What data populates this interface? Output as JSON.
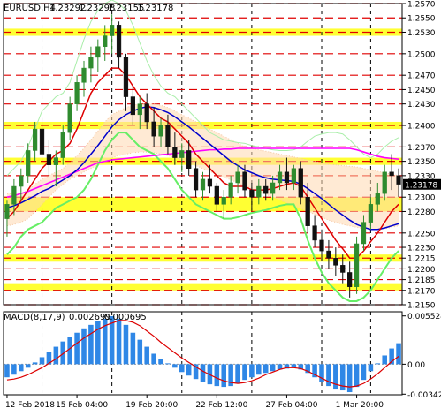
{
  "chart_data": [
    {
      "type": "candlestick",
      "title": "EURUSD,H4",
      "ohlc_readout": {
        "open": "1.23292",
        "high": "1.23298",
        "low": "1.23155",
        "close": "1.23178"
      },
      "ylim": [
        1.215,
        1.257
      ],
      "price_tick_labels": [
        "1.2570",
        "1.2550",
        "1.2530",
        "1.2500",
        "1.2470",
        "1.2450",
        "1.2430",
        "1.2400",
        "1.2370",
        "1.2350",
        "1.2330",
        "1.2300",
        "1.2280",
        "1.2250",
        "1.2230",
        "1.2215",
        "1.2200",
        "1.2185",
        "1.2170",
        "1.2150"
      ],
      "tick_values": [
        1.257,
        1.255,
        1.253,
        1.25,
        1.247,
        1.245,
        1.243,
        1.24,
        1.237,
        1.235,
        1.233,
        1.23,
        1.228,
        1.225,
        1.223,
        1.2215,
        1.22,
        1.2185,
        1.217,
        1.215
      ],
      "current_price_label": "1.23178",
      "current_price": 1.23178,
      "colors": {
        "bull": "#2e8b2e",
        "bear": "#111111",
        "level_line": "#e00000",
        "zone_fill": "#ffff33",
        "sma_fast": "#dd0000",
        "sma_slow": "#0000cc",
        "long_ma": "#ff00ff",
        "bollinger": "#66ee66",
        "envelope": "#aaeeaa",
        "cloud_a": "#f5c7a3",
        "cloud_b": "#ffd8b0",
        "macd_hist": "#2f87e6",
        "macd_signal": "#dd0000"
      },
      "zones": [
        [
          1.2525,
          1.2535
        ],
        [
          1.2395,
          1.2405
        ],
        [
          1.2345,
          1.2355
        ],
        [
          1.228,
          1.23
        ],
        [
          1.221,
          1.222
        ],
        [
          1.217,
          1.218
        ]
      ],
      "candles": [
        [
          1.227,
          1.2295,
          1.2245,
          1.229
        ],
        [
          1.229,
          1.2325,
          1.2275,
          1.2315
        ],
        [
          1.2315,
          1.234,
          1.2295,
          1.233
        ],
        [
          1.233,
          1.2375,
          1.232,
          1.2365
        ],
        [
          1.2365,
          1.2405,
          1.235,
          1.2395
        ],
        [
          1.2395,
          1.241,
          1.235,
          1.236
        ],
        [
          1.236,
          1.238,
          1.233,
          1.2345
        ],
        [
          1.2345,
          1.2365,
          1.2315,
          1.2355
        ],
        [
          1.2355,
          1.24,
          1.2345,
          1.239
        ],
        [
          1.239,
          1.244,
          1.238,
          1.243
        ],
        [
          1.243,
          1.247,
          1.242,
          1.246
        ],
        [
          1.246,
          1.249,
          1.244,
          1.248
        ],
        [
          1.248,
          1.251,
          1.246,
          1.2495
        ],
        [
          1.2495,
          1.252,
          1.2475,
          1.251
        ],
        [
          1.251,
          1.254,
          1.249,
          1.2525
        ],
        [
          1.2525,
          1.2555,
          1.25,
          1.254
        ],
        [
          1.254,
          1.2545,
          1.248,
          1.2495
        ],
        [
          1.2495,
          1.25,
          1.242,
          1.244
        ],
        [
          1.244,
          1.2455,
          1.24,
          1.2415
        ],
        [
          1.2415,
          1.244,
          1.2395,
          1.243
        ],
        [
          1.243,
          1.2445,
          1.2395,
          1.2405
        ],
        [
          1.2405,
          1.2425,
          1.237,
          1.2385
        ],
        [
          1.2385,
          1.241,
          1.237,
          1.24
        ],
        [
          1.24,
          1.2415,
          1.236,
          1.237
        ],
        [
          1.237,
          1.239,
          1.2345,
          1.2355
        ],
        [
          1.2355,
          1.2375,
          1.2335,
          1.2365
        ],
        [
          1.2365,
          1.238,
          1.233,
          1.234
        ],
        [
          1.234,
          1.235,
          1.23,
          1.231
        ],
        [
          1.231,
          1.2335,
          1.2295,
          1.2325
        ],
        [
          1.2325,
          1.2345,
          1.2305,
          1.2315
        ],
        [
          1.2315,
          1.232,
          1.228,
          1.229
        ],
        [
          1.229,
          1.231,
          1.227,
          1.23
        ],
        [
          1.23,
          1.233,
          1.229,
          1.232
        ],
        [
          1.232,
          1.2345,
          1.2305,
          1.2335
        ],
        [
          1.2335,
          1.2345,
          1.23,
          1.231
        ],
        [
          1.231,
          1.232,
          1.2285,
          1.23
        ],
        [
          1.23,
          1.2325,
          1.229,
          1.2315
        ],
        [
          1.2315,
          1.2325,
          1.2295,
          1.2305
        ],
        [
          1.2305,
          1.233,
          1.2295,
          1.232
        ],
        [
          1.232,
          1.2345,
          1.231,
          1.2335
        ],
        [
          1.2335,
          1.2355,
          1.231,
          1.232
        ],
        [
          1.232,
          1.2345,
          1.231,
          1.234
        ],
        [
          1.234,
          1.235,
          1.229,
          1.23
        ],
        [
          1.23,
          1.232,
          1.225,
          1.226
        ],
        [
          1.226,
          1.2275,
          1.223,
          1.224
        ],
        [
          1.224,
          1.2255,
          1.2215,
          1.2225
        ],
        [
          1.2225,
          1.224,
          1.22,
          1.2215
        ],
        [
          1.2215,
          1.223,
          1.219,
          1.2205
        ],
        [
          1.2205,
          1.222,
          1.218,
          1.2195
        ],
        [
          1.2195,
          1.221,
          1.216,
          1.2175
        ],
        [
          1.2175,
          1.2245,
          1.2165,
          1.2235
        ],
        [
          1.2235,
          1.2275,
          1.2225,
          1.2265
        ],
        [
          1.2265,
          1.23,
          1.2255,
          1.229
        ],
        [
          1.229,
          1.232,
          1.228,
          1.2305
        ],
        [
          1.2305,
          1.2345,
          1.2295,
          1.2335
        ],
        [
          1.2335,
          1.236,
          1.231,
          1.233
        ],
        [
          1.233,
          1.234,
          1.23,
          1.2318
        ]
      ],
      "sma_fast": [
        1.227,
        1.228,
        1.2295,
        1.231,
        1.2325,
        1.234,
        1.235,
        1.236,
        1.2365,
        1.2375,
        1.2395,
        1.242,
        1.2445,
        1.246,
        1.247,
        1.248,
        1.248,
        1.247,
        1.2455,
        1.244,
        1.243,
        1.242,
        1.241,
        1.2405,
        1.2395,
        1.2385,
        1.2375,
        1.236,
        1.235,
        1.234,
        1.233,
        1.232,
        1.2315,
        1.2315,
        1.2315,
        1.231,
        1.231,
        1.231,
        1.2312,
        1.2315,
        1.2318,
        1.232,
        1.2315,
        1.23,
        1.2285,
        1.227,
        1.2255,
        1.224,
        1.2228,
        1.2215,
        1.2215,
        1.2225,
        1.2238,
        1.225,
        1.2265,
        1.228,
        1.229
      ],
      "sma_slow": [
        1.2285,
        1.2288,
        1.2292,
        1.2297,
        1.2302,
        1.2308,
        1.2312,
        1.2318,
        1.2324,
        1.233,
        1.2338,
        1.2348,
        1.236,
        1.2372,
        1.2385,
        1.2398,
        1.2408,
        1.2415,
        1.242,
        1.2424,
        1.2426,
        1.2425,
        1.2422,
        1.2418,
        1.2412,
        1.2405,
        1.2398,
        1.239,
        1.2382,
        1.2374,
        1.2366,
        1.2358,
        1.235,
        1.2344,
        1.2338,
        1.2334,
        1.233,
        1.2327,
        1.2325,
        1.2324,
        1.2323,
        1.2322,
        1.2318,
        1.2312,
        1.2305,
        1.2298,
        1.229,
        1.2282,
        1.2275,
        1.2268,
        1.2262,
        1.2258,
        1.2255,
        1.2255,
        1.2257,
        1.226,
        1.2263
      ],
      "long_ma": [
        1.23,
        1.2302,
        1.2305,
        1.2308,
        1.2312,
        1.2316,
        1.232,
        1.2324,
        1.2328,
        1.2332,
        1.2336,
        1.234,
        1.2344,
        1.2348,
        1.235,
        1.2352,
        1.2353,
        1.2354,
        1.2355,
        1.2356,
        1.2357,
        1.2358,
        1.2359,
        1.236,
        1.2361,
        1.2362,
        1.2363,
        1.2364,
        1.2365,
        1.2366,
        1.2366,
        1.2367,
        1.2367,
        1.2368,
        1.2368,
        1.2368,
        1.2368,
        1.2368,
        1.2368,
        1.2368,
        1.2368,
        1.2368,
        1.2368,
        1.2368,
        1.2368,
        1.2368,
        1.2368,
        1.2368,
        1.2368,
        1.2368,
        1.2366,
        1.2363,
        1.236,
        1.2357,
        1.2355,
        1.2354,
        1.2353
      ],
      "bb_upper": [
        1.233,
        1.234,
        1.235,
        1.237,
        1.2395,
        1.242,
        1.243,
        1.244,
        1.2445,
        1.246,
        1.249,
        1.252,
        1.2545,
        1.256,
        1.257,
        1.2575,
        1.257,
        1.256,
        1.254,
        1.2515,
        1.249,
        1.247,
        1.2455,
        1.2445,
        1.244,
        1.243,
        1.242,
        1.241,
        1.24,
        1.239,
        1.2385,
        1.238,
        1.2378,
        1.2376,
        1.2375,
        1.2372,
        1.237,
        1.2368,
        1.2366,
        1.2365,
        1.2365,
        1.2366,
        1.237,
        1.2378,
        1.2385,
        1.2388,
        1.239,
        1.239,
        1.2388,
        1.238,
        1.237,
        1.236,
        1.2355,
        1.236,
        1.237,
        1.2378,
        1.2383
      ],
      "bb_lower": [
        1.222,
        1.223,
        1.2245,
        1.2255,
        1.226,
        1.2265,
        1.2275,
        1.2285,
        1.229,
        1.2295,
        1.23,
        1.231,
        1.2325,
        1.2345,
        1.2365,
        1.238,
        1.239,
        1.239,
        1.238,
        1.237,
        1.2365,
        1.236,
        1.235,
        1.234,
        1.2325,
        1.231,
        1.23,
        1.229,
        1.2285,
        1.228,
        1.2275,
        1.227,
        1.227,
        1.2272,
        1.2275,
        1.2278,
        1.228,
        1.2282,
        1.2285,
        1.2288,
        1.229,
        1.229,
        1.227,
        1.224,
        1.2215,
        1.2195,
        1.218,
        1.217,
        1.216,
        1.2155,
        1.2155,
        1.216,
        1.217,
        1.2185,
        1.22,
        1.2215,
        1.2225
      ],
      "cloud_a": [
        1.2305,
        1.2305,
        1.2305,
        1.231,
        1.2318,
        1.2325,
        1.233,
        1.2335,
        1.234,
        1.2348,
        1.2358,
        1.2368,
        1.238,
        1.2392,
        1.2405,
        1.2415,
        1.242,
        1.2425,
        1.2428,
        1.243,
        1.243,
        1.243,
        1.2428,
        1.2425,
        1.242,
        1.2415,
        1.241,
        1.2405,
        1.24,
        1.2395,
        1.239,
        1.2385,
        1.238,
        1.2375,
        1.237,
        1.2368,
        1.2366,
        1.2364,
        1.2362,
        1.236,
        1.2358,
        1.2356,
        1.2354,
        1.2352,
        1.235,
        1.2348,
        1.2346,
        1.2345,
        1.2344,
        1.2343,
        1.2342,
        1.234,
        1.2338,
        1.2336,
        1.2334,
        1.2332,
        1.233
      ],
      "cloud_b": [
        1.226,
        1.2262,
        1.2265,
        1.227,
        1.228,
        1.229,
        1.23,
        1.231,
        1.2318,
        1.2325,
        1.233,
        1.2335,
        1.234,
        1.2345,
        1.235,
        1.2355,
        1.2358,
        1.236,
        1.2362,
        1.2363,
        1.2363,
        1.2362,
        1.236,
        1.2358,
        1.2355,
        1.2352,
        1.2348,
        1.2344,
        1.234,
        1.2336,
        1.2332,
        1.2328,
        1.2324,
        1.232,
        1.2316,
        1.2312,
        1.2308,
        1.2304,
        1.23,
        1.2296,
        1.2292,
        1.2288,
        1.2284,
        1.228,
        1.2276,
        1.2272,
        1.2268,
        1.2265,
        1.2262,
        1.226,
        1.2258,
        1.2256,
        1.2255,
        1.2255,
        1.2256,
        1.2258,
        1.226
      ],
      "x_labels": [
        "12 Feb 2018",
        "15 Feb 04:00",
        "19 Feb 20:00",
        "22 Feb 12:00",
        "27 Feb 04:00",
        "1 Mar 20:00"
      ],
      "x_label_index": [
        0,
        10,
        20,
        30,
        40,
        50
      ],
      "grid_vertical_index": [
        5,
        15,
        25,
        35,
        45,
        52
      ],
      "grid": true
    },
    {
      "type": "bar",
      "title": "MACD(8,17,9)",
      "readout": [
        "0.002699",
        "0.000695"
      ],
      "ylim": [
        -0.0035,
        0.006
      ],
      "tick_labels": [
        "0.005524",
        "0.00",
        "-0.003429"
      ],
      "tick_values": [
        0.005524,
        0.0,
        -0.003429
      ],
      "histogram": [
        -0.0015,
        -0.0012,
        -0.0008,
        -0.0004,
        0.0002,
        0.0008,
        0.0014,
        0.002,
        0.0026,
        0.0031,
        0.0036,
        0.0041,
        0.0045,
        0.0049,
        0.0052,
        0.0055,
        0.0052,
        0.0045,
        0.0036,
        0.0028,
        0.002,
        0.0012,
        0.0006,
        0.0001,
        -0.0004,
        -0.0009,
        -0.0013,
        -0.0017,
        -0.002,
        -0.0023,
        -0.0025,
        -0.0026,
        -0.0025,
        -0.0022,
        -0.0018,
        -0.0015,
        -0.0012,
        -0.001,
        -0.0008,
        -0.0006,
        -0.0005,
        -0.0004,
        -0.0006,
        -0.001,
        -0.0015,
        -0.002,
        -0.0025,
        -0.0028,
        -0.003,
        -0.0032,
        -0.0026,
        -0.0018,
        -0.0008,
        0.0001,
        0.001,
        0.0018,
        0.0024
      ],
      "signal": [
        -0.0018,
        -0.0017,
        -0.0015,
        -0.0012,
        -0.0008,
        -0.0004,
        0.0001,
        0.0006,
        0.0012,
        0.0018,
        0.0024,
        0.003,
        0.0035,
        0.004,
        0.0044,
        0.0047,
        0.005,
        0.005,
        0.0048,
        0.0044,
        0.0038,
        0.0032,
        0.0025,
        0.0019,
        0.0013,
        0.0007,
        0.0002,
        -0.0003,
        -0.0008,
        -0.0012,
        -0.0016,
        -0.0019,
        -0.0021,
        -0.0022,
        -0.0021,
        -0.0019,
        -0.0016,
        -0.0012,
        -0.0009,
        -0.0006,
        -0.0004,
        -0.0004,
        -0.0005,
        -0.0008,
        -0.0012,
        -0.0016,
        -0.002,
        -0.0023,
        -0.0025,
        -0.0026,
        -0.0025,
        -0.0022,
        -0.0017,
        -0.0011,
        -0.0004,
        0.0003,
        0.0009
      ]
    }
  ]
}
